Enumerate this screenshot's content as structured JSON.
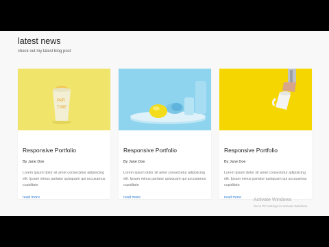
{
  "section": {
    "title": "latest news",
    "subtitle": "check out my latest blog post"
  },
  "cards": [
    {
      "title": "Responsive Portfolio",
      "author": "By Jane Doe",
      "excerpt": "Lorem ipsum dolor sit amet consectetur adipisicing elit. Ipsam minus pariatur quisquam qui accusamus cupiditate",
      "link": "read more",
      "image_bg": "#f0e46a"
    },
    {
      "title": "Responsive Portfolio",
      "author": "By Jane Doe",
      "excerpt": "Lorem ipsum dolor sit amet consectetur adipisicing elit. Ipsam minus pariatur quisquam qui accusamus cupiditate",
      "link": "read more",
      "image_bg": "#8fd4ee"
    },
    {
      "title": "Responsive Portfolio",
      "author": "By Jane Doe",
      "excerpt": "Lorem ipsum dolor sit amet consectetur adipisicing elit. Ipsam minus pariatur quisquam qui accusamus cupiditate",
      "link": "read more",
      "image_bg": "#f6d600"
    }
  ],
  "watermark": {
    "title": "Activate Windows",
    "subtitle": "Go to PC settings to activate Windows."
  },
  "colors": {
    "link": "#2f7fd4",
    "page_bg": "#f8f8f8"
  }
}
